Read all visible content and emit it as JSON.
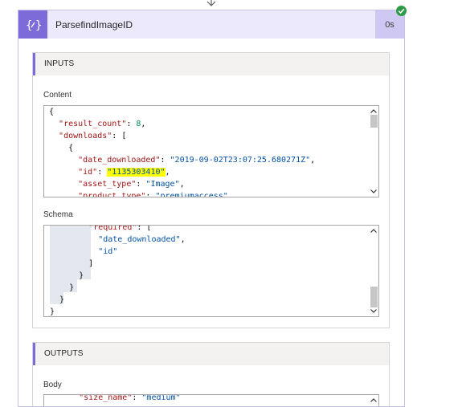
{
  "action": {
    "title": "ParsefindImageID",
    "duration": "0s",
    "icon": "parse-json-icon",
    "status": "succeeded-check-icon"
  },
  "inputs": {
    "header": "INPUTS",
    "content_label": "Content",
    "content_lines": [
      "{",
      "  \"result_count\": 8,",
      "  \"downloads\": [",
      "    {",
      "      \"date_downloaded\": \"2019-09-02T23:07:25.680271Z\",",
      "      \"id\": \"1135303410\",",
      "      \"asset_type\": \"Image\",",
      "      \"product_type\": \"premiumaccess\""
    ],
    "schema_label": "Schema",
    "schema_lines": [
      "        \"required\": [",
      "          \"date_downloaded\",",
      "          \"id\"",
      "        ]",
      "      }",
      "    }",
      "  }",
      "}"
    ]
  },
  "outputs": {
    "header": "OUTPUTS",
    "body_label": "Body",
    "body_lines": [
      "      \"size_name\": \"medium\""
    ]
  },
  "colors": {
    "accent": "#7c6bd8",
    "header_bg": "#ede9fc",
    "highlight": "#ffff00",
    "success": "#2e9c47"
  }
}
